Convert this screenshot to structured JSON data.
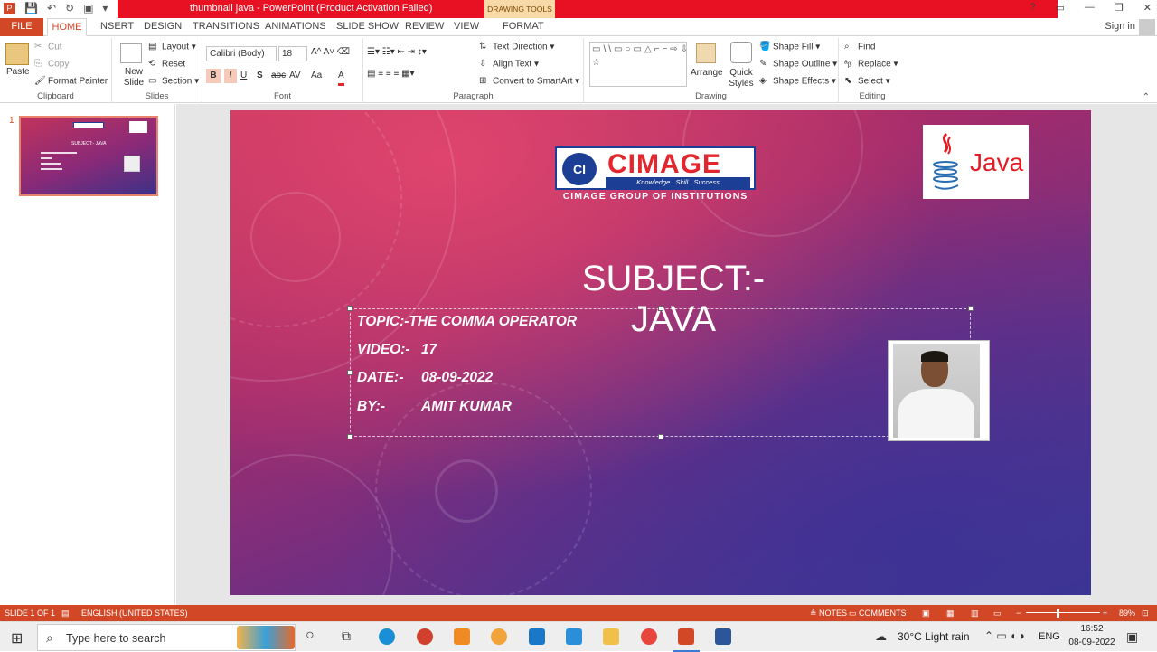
{
  "window": {
    "title": "thumbnail java  -  PowerPoint (Product Activation Failed)",
    "context_tab_group": "DRAWING TOOLS",
    "controls": [
      "?",
      "▭",
      "—",
      "❐",
      "✕"
    ],
    "sign_in": "Sign in"
  },
  "tabs": [
    "FILE",
    "HOME",
    "INSERT",
    "DESIGN",
    "TRANSITIONS",
    "ANIMATIONS",
    "SLIDE SHOW",
    "REVIEW",
    "VIEW",
    "FORMAT"
  ],
  "ribbon": {
    "clipboard": {
      "label": "Clipboard",
      "paste": "Paste",
      "cut": "Cut",
      "copy": "Copy",
      "format_painter": "Format Painter"
    },
    "slides": {
      "label": "Slides",
      "new_slide": "New Slide",
      "layout": "Layout",
      "reset": "Reset",
      "section": "Section"
    },
    "font": {
      "label": "Font",
      "name": "Calibri (Body)",
      "size": "18",
      "bold": "B",
      "italic": "I",
      "underline": "U",
      "shadow": "S",
      "strike": "abc",
      "spacing": "AV",
      "case": "Aa",
      "color": "A"
    },
    "paragraph": {
      "label": "Paragraph",
      "text_direction": "Text Direction",
      "align_text": "Align Text",
      "convert_smartart": "Convert to SmartArt"
    },
    "drawing": {
      "label": "Drawing",
      "arrange": "Arrange",
      "quick_styles": "Quick Styles",
      "shape_fill": "Shape Fill",
      "shape_outline": "Shape Outline",
      "shape_effects": "Shape Effects",
      "shapes_gallery": "▭\\\\▭○▭△⌐⌐⇨⇩△⌐{}☆"
    },
    "editing": {
      "label": "Editing",
      "find": "Find",
      "replace": "Replace",
      "select": "Select"
    }
  },
  "thumbnail": {
    "number": "1",
    "subject": "SUBJECT:- JAVA"
  },
  "slide": {
    "logo_name": "CIMAGE",
    "logo_emblem": "CI",
    "logo_tagline": "Knowledge . Skill . Success",
    "logo_caption": "CIMAGE GROUP OF INSTITUTIONS",
    "java_logo_text": "Java",
    "subject": "SUBJECT:- JAVA",
    "lines": [
      {
        "label": "TOPIC:-THE COMMA  OPERATOR",
        "value": ""
      },
      {
        "label": "VIDEO:-",
        "value": "17"
      },
      {
        "label": "DATE:-",
        "value": "08-09-2022"
      },
      {
        "label": "BY:-",
        "value": "AMIT KUMAR"
      }
    ]
  },
  "statusbar": {
    "slide": "SLIDE 1 OF 1",
    "language": "ENGLISH (UNITED STATES)",
    "notes": "NOTES",
    "comments": "COMMENTS",
    "zoom": "89%"
  },
  "taskbar": {
    "search_placeholder": "Type here to search",
    "weather": "30°C  Light rain",
    "lang": "ENG",
    "time": "16:52",
    "date": "08-09-2022"
  }
}
